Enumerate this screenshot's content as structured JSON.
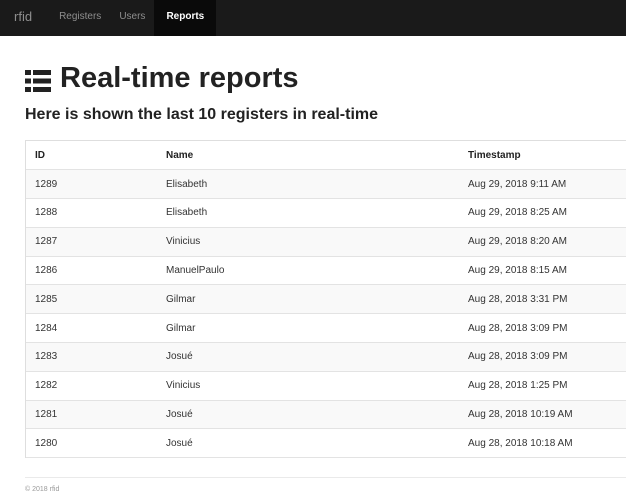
{
  "navbar": {
    "brand": "rfid",
    "items": [
      {
        "label": "Registers",
        "active": false
      },
      {
        "label": "Users",
        "active": false
      },
      {
        "label": "Reports",
        "active": true
      }
    ]
  },
  "page": {
    "title": "Real-time reports",
    "title_icon": "list-icon",
    "subtitle": "Here is shown the last 10 registers in real-time"
  },
  "table": {
    "columns": [
      "ID",
      "Name",
      "Timestamp"
    ],
    "rows": [
      {
        "id": "1289",
        "name": "Elisabeth",
        "timestamp": "Aug 29, 2018 9:11 AM"
      },
      {
        "id": "1288",
        "name": "Elisabeth",
        "timestamp": "Aug 29, 2018 8:25 AM"
      },
      {
        "id": "1287",
        "name": "Vinicius",
        "timestamp": "Aug 29, 2018 8:20 AM"
      },
      {
        "id": "1286",
        "name": "ManuelPaulo",
        "timestamp": "Aug 29, 2018 8:15 AM"
      },
      {
        "id": "1285",
        "name": "Gilmar",
        "timestamp": "Aug 28, 2018 3:31 PM"
      },
      {
        "id": "1284",
        "name": "Gilmar",
        "timestamp": "Aug 28, 2018 3:09 PM"
      },
      {
        "id": "1283",
        "name": "Josué",
        "timestamp": "Aug 28, 2018 3:09 PM"
      },
      {
        "id": "1282",
        "name": "Vinicius",
        "timestamp": "Aug 28, 2018 1:25 PM"
      },
      {
        "id": "1281",
        "name": "Josué",
        "timestamp": "Aug 28, 2018 10:19 AM"
      },
      {
        "id": "1280",
        "name": "Josué",
        "timestamp": "Aug 28, 2018 10:18 AM"
      }
    ]
  },
  "footer": {
    "text": "© 2018 rfid"
  }
}
